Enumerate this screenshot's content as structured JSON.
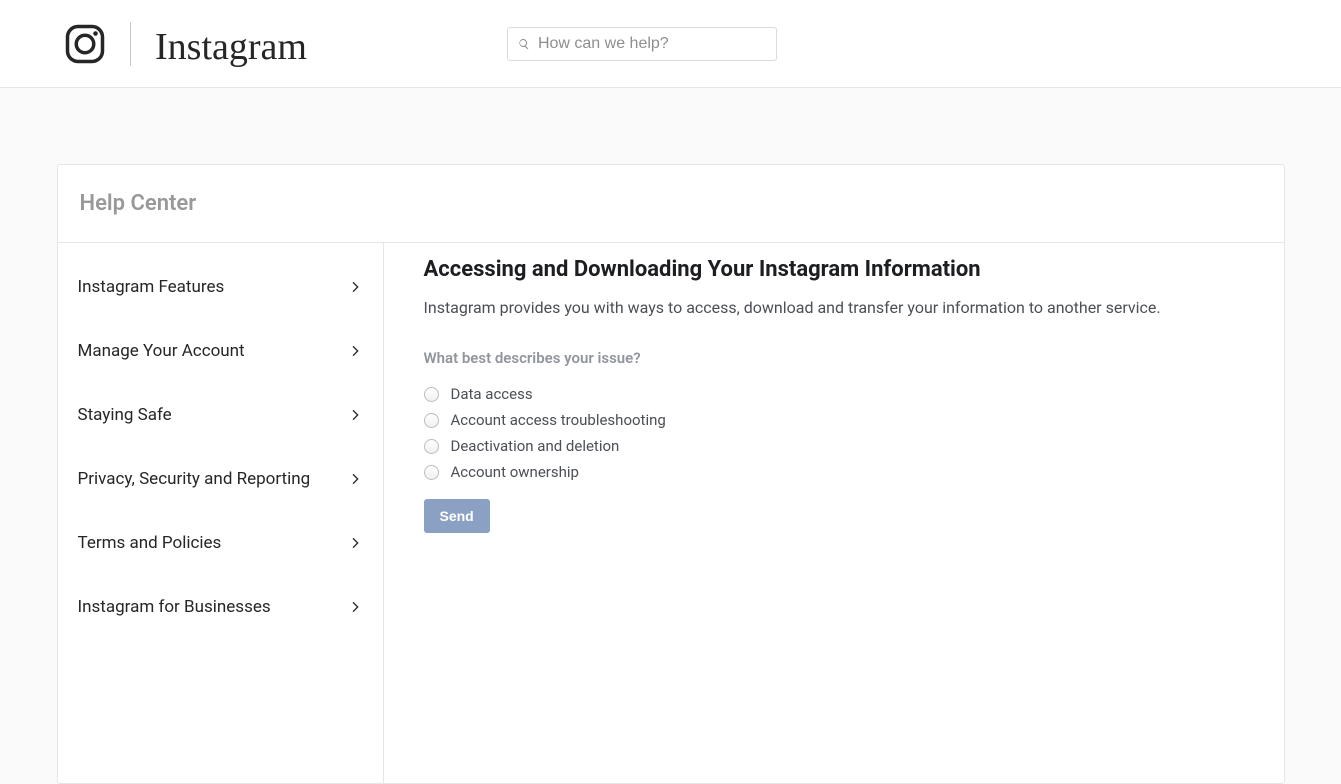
{
  "header": {
    "brand": "Instagram",
    "search_placeholder": "How can we help?"
  },
  "page_title": "Help Center",
  "sidebar": {
    "items": [
      {
        "label": "Instagram Features"
      },
      {
        "label": "Manage Your Account"
      },
      {
        "label": "Staying Safe"
      },
      {
        "label": "Privacy, Security and Reporting"
      },
      {
        "label": "Terms and Policies"
      },
      {
        "label": "Instagram for Businesses"
      }
    ]
  },
  "main": {
    "heading": "Accessing and Downloading Your Instagram Information",
    "intro": "Instagram provides you with ways to access, download and transfer your information to another service.",
    "question": "What best describes your issue?",
    "options": [
      "Data access",
      "Account access troubleshooting",
      "Deactivation and deletion",
      "Account ownership"
    ],
    "send_label": "Send"
  }
}
